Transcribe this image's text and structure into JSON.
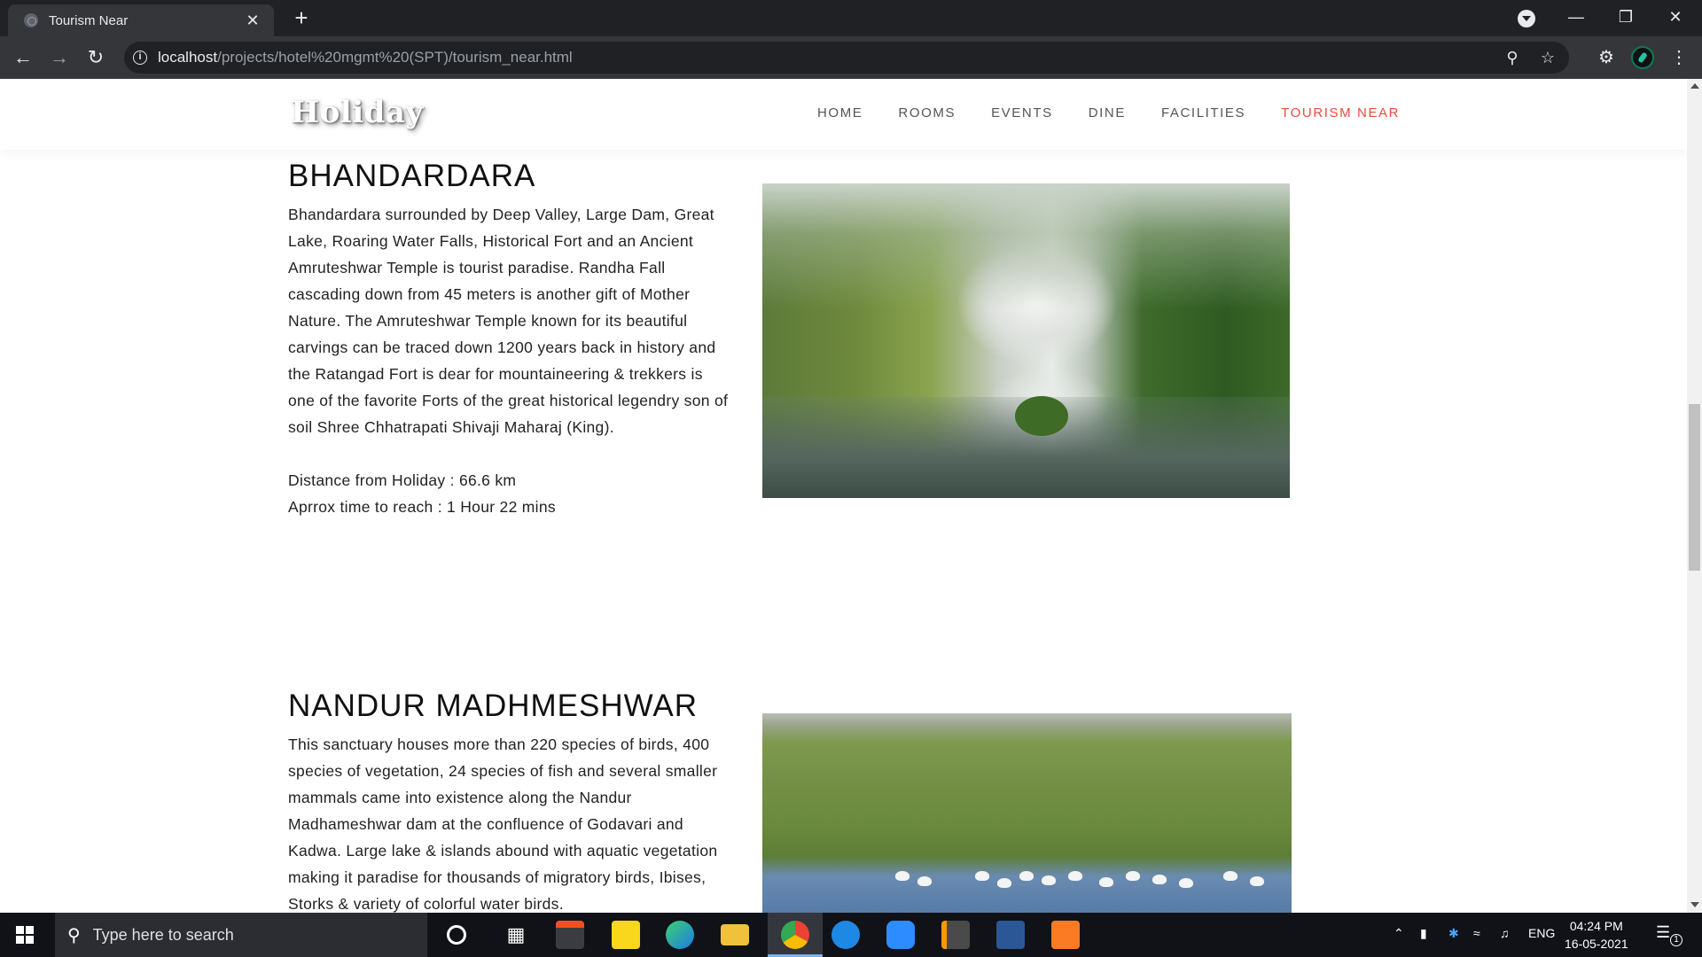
{
  "browser": {
    "tab_title": "Tourism Near",
    "tab_close": "✕",
    "new_tab": "+",
    "url_host": "localhost",
    "url_path": "/projects/hotel%20mgmt%20(SPT)/tourism_near.html"
  },
  "site": {
    "logo": "Holiday",
    "nav": [
      {
        "label": "HOME"
      },
      {
        "label": "ROOMS"
      },
      {
        "label": "EVENTS"
      },
      {
        "label": "DINE"
      },
      {
        "label": "FACILITIES"
      },
      {
        "label": "TOURISM NEAR",
        "active": true
      }
    ]
  },
  "sections": [
    {
      "title": "BHANDARDARA",
      "text": "Bhandardara surrounded by Deep Valley, Large Dam, Great Lake, Roaring Water Falls, Historical Fort and an Ancient Amruteshwar Temple is tourist paradise. Randha Fall cascading down from 45 meters is another gift of Mother Nature. The Amruteshwar Temple known for its beautiful carvings can be traced down 1200 years back in history and the Ratangad Fort is dear for mountaineering & trekkers is one of the favorite Forts of the great historical legendry son of soil Shree Chhatrapati Shivaji Maharaj (King).",
      "distance": "Distance from Holiday : 66.6 km",
      "time": "Aprrox time to reach : 1 Hour 22 mins"
    },
    {
      "title": "NANDUR MADHMESHWAR",
      "text": "This sanctuary houses more than 220 species of birds, 400 species of vegetation, 24 species of fish and several smaller mammals came into existence along the Nandur Madhameshwar dam at the confluence of Godavari and Kadwa. Large lake & islands abound with aquatic vegetation making it paradise for thousands of migratory birds, Ibises, Storks & variety of colorful water birds."
    }
  ],
  "taskbar": {
    "search_placeholder": "Type here to search",
    "language": "ENG",
    "time": "04:24 PM",
    "date": "16-05-2021",
    "notification_count": "1"
  },
  "colors": {
    "accent": "#e74c3c",
    "chrome_dark": "#202124",
    "chrome_toolbar": "#35363a",
    "taskbar": "#101218"
  }
}
